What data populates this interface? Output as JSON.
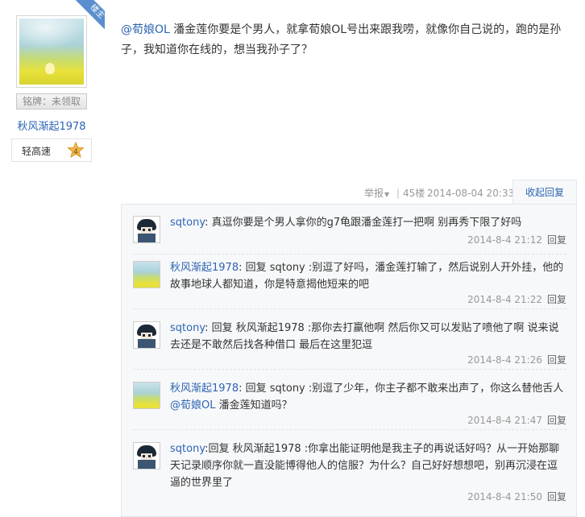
{
  "author": {
    "badge": "楼主",
    "medal": "铭牌：未领取",
    "name": "秋风渐起1978",
    "level_name": "轻高速",
    "level": "4"
  },
  "post": {
    "mention": "@荀娘OL",
    "content": " 潘金莲你要是个男人，就拿荀娘OL号出来跟我唠，就像你自己说的，跑的是孙子，我知道你在线的，想当我孙子了？",
    "report": "举报",
    "floor": "45楼",
    "date": "2014-08-04 20:33",
    "reply_tab": "收起回复"
  },
  "replies": [
    {
      "user": "sqtony",
      "text": ": 真逗你要是个男人拿你的g7龟跟潘金莲打一把啊 别再秀下限了好吗",
      "time": "2014-8-4 21:12",
      "reply": "回复",
      "avatar": "sqtony-avatar"
    },
    {
      "user": "秋风渐起1978",
      "text": ": 回复 sqtony :别逗了好吗，潘金莲打输了，然后说别人开外挂，他的故事地球人都知道，你是特意揭他短来的吧",
      "time": "2014-8-4 21:22",
      "reply": "回复",
      "avatar": "qiufeng-avatar"
    },
    {
      "user": "sqtony",
      "text": ": 回复 秋风渐起1978 :那你去打赢他啊 然后你又可以发贴了喷他了啊 说来说去还是不敢然后找各种借口 最后在这里犯逗",
      "time": "2014-8-4 21:26",
      "reply": "回复",
      "avatar": "sqtony-avatar"
    },
    {
      "user": "秋风渐起1978",
      "text_before": ": 回复 sqtony :别逗了少年，你主子都不敢来出声了，你这么替他舌人 ",
      "mention": "@荀娘OL",
      "text_after": " 潘金莲知道吗？",
      "time": "2014-8-4 21:47",
      "reply": "回复",
      "avatar": "qiufeng-avatar"
    },
    {
      "user": "sqtony",
      "text": ":回复 秋风渐起1978 :你拿出能证明他是我主子的再说话好吗？从一开始那聊天记录顺序你就一直没能博得他人的信服？为什么？自己好好想想吧，别再沉浸在逗逼的世界里了",
      "time": "2014-8-4 21:50",
      "reply": "回复",
      "avatar": "sqtony-avatar"
    }
  ]
}
